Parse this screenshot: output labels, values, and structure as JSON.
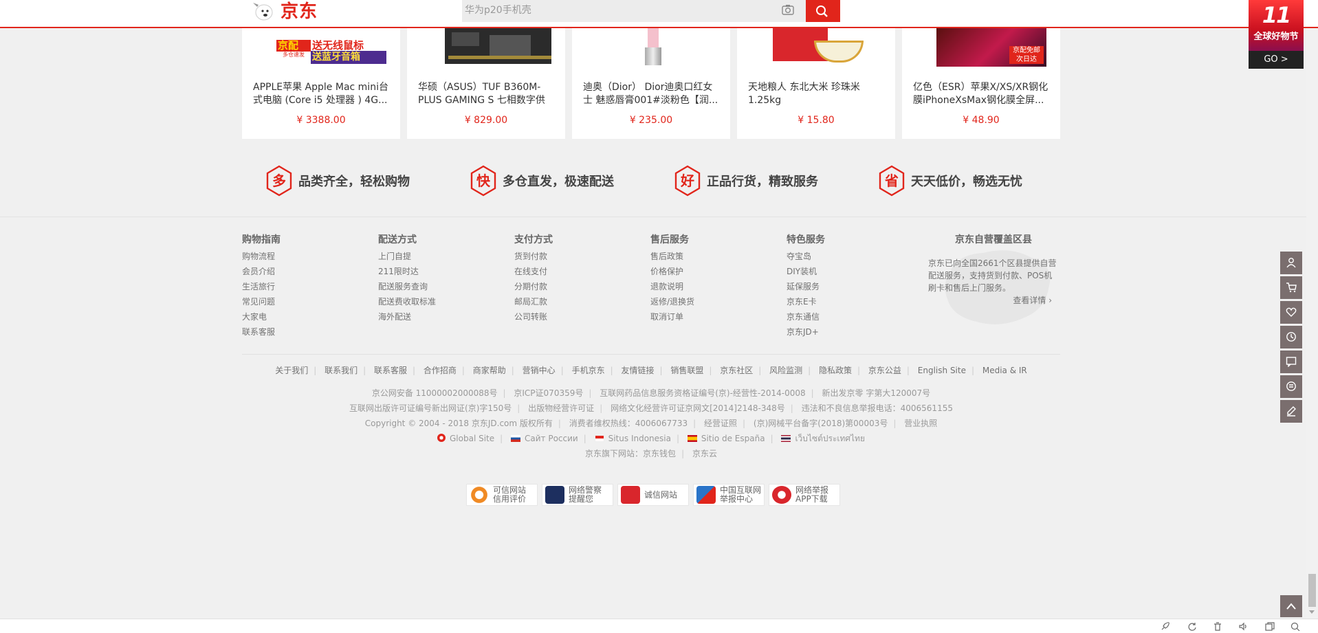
{
  "header": {
    "brand": "京东",
    "search_placeholder": "华为p20手机壳",
    "camera_icon": "camera-icon",
    "search_icon": "search-icon"
  },
  "promo": {
    "big": "11",
    "title": "全球好物节",
    "go": "GO >"
  },
  "products": [
    {
      "name": "APPLE苹果 Apple Mac mini台式电脑 (Core i5 处理器 ) 4G...",
      "price": "¥ 3388.00",
      "img_text_1": "送无线鼠标",
      "img_text_2": "送蓝牙音箱",
      "img_badge": "京配",
      "img_badge_sub": "多仓速发"
    },
    {
      "name": "华硕（ASUS）TUF B360M-PLUS GAMING S 七相数字供电...",
      "price": "¥ 829.00"
    },
    {
      "name": "迪奥（Dior） Dior迪奥口红女士 魅惑唇膏001#淡粉色【润...",
      "price": "¥ 235.00"
    },
    {
      "name": "天地粮人 东北大米 珍珠米1.25kg",
      "price": "¥ 15.80"
    },
    {
      "name": "亿色（ESR）苹果X/XS/XR钢化膜iPhoneXsMax钢化膜全屏...",
      "price": "¥ 48.90",
      "img_tag_1": "京配免邮",
      "img_tag_2": "次日达"
    }
  ],
  "services": [
    {
      "char": "多",
      "text": "品类齐全，轻松购物"
    },
    {
      "char": "快",
      "text": "多仓直发，极速配送"
    },
    {
      "char": "好",
      "text": "正品行货，精致服务"
    },
    {
      "char": "省",
      "text": "天天低价，畅选无忧"
    }
  ],
  "footer_columns": [
    {
      "title": "购物指南",
      "items": [
        "购物流程",
        "会员介绍",
        "生活旅行",
        "常见问题",
        "大家电",
        "联系客服"
      ]
    },
    {
      "title": "配送方式",
      "items": [
        "上门自提",
        "211限时达",
        "配送服务查询",
        "配送费收取标准",
        "海外配送"
      ]
    },
    {
      "title": "支付方式",
      "items": [
        "货到付款",
        "在线支付",
        "分期付款",
        "邮局汇款",
        "公司转账"
      ]
    },
    {
      "title": "售后服务",
      "items": [
        "售后政策",
        "价格保护",
        "退款说明",
        "返修/退换货",
        "取消订单"
      ]
    },
    {
      "title": "特色服务",
      "items": [
        "夺宝岛",
        "DIY装机",
        "延保服务",
        "京东E卡",
        "京东通信",
        "京东JD+"
      ]
    }
  ],
  "coverage": {
    "title": "京东自营覆盖区县",
    "text": "京东已向全国2661个区县提供自营配送服务，支持货到付款、POS机刷卡和售后上门服务。",
    "more": "查看详情 ›"
  },
  "bottom_links": [
    "关于我们",
    "联系我们",
    "联系客服",
    "合作招商",
    "商家帮助",
    "营销中心",
    "手机京东",
    "友情链接",
    "销售联盟",
    "京东社区",
    "风险监测",
    "隐私政策",
    "京东公益",
    "English Site",
    "Media & IR"
  ],
  "license_lines": [
    [
      "京公网安备 11000002000088号",
      "京ICP证070359号",
      "互联网药品信息服务资格证编号(京)-经营性-2014-0008",
      "新出发京零 字第大120007号"
    ],
    [
      "互联网出版许可证编号新出网证(京)字150号",
      "出版物经营许可证",
      "网络文化经营许可证京网文[2014]2148-348号",
      "违法和不良信息举报电话：4006561155"
    ],
    [
      "Copyright © 2004 - 2018  京东JD.com 版权所有",
      "消费者维权热线：4006067733",
      "经营证照",
      "(京)网械平台备字(2018)第00003号",
      "营业执照"
    ]
  ],
  "sites": [
    "Global Site",
    "Сайт России",
    "Situs Indonesia",
    "Sitio de España",
    "เว็บไซต์ประเทศไทย"
  ],
  "sub_sites": [
    "京东旗下网站：京东钱包",
    "京东云"
  ],
  "badges": [
    {
      "l1": "可信网站",
      "l2": "信用评价",
      "color": "#f08a24"
    },
    {
      "l1": "网络警察",
      "l2": "提醒您",
      "color": "#1d2f5f"
    },
    {
      "l1": "诚信网站",
      "l2": "",
      "color": "#d9262c"
    },
    {
      "l1": "中国互联网",
      "l2": "举报中心",
      "color": "#2a74c9"
    },
    {
      "l1": "网络举报",
      "l2": "APP下载",
      "color": "#d9262c"
    }
  ],
  "right_toolbar": [
    "user-icon",
    "cart-icon",
    "heart-icon",
    "history-icon",
    "message-icon",
    "feedback-icon",
    "edit-icon"
  ],
  "colors": {
    "accent": "#e1251b",
    "toolbar": "#7a6e6e"
  }
}
